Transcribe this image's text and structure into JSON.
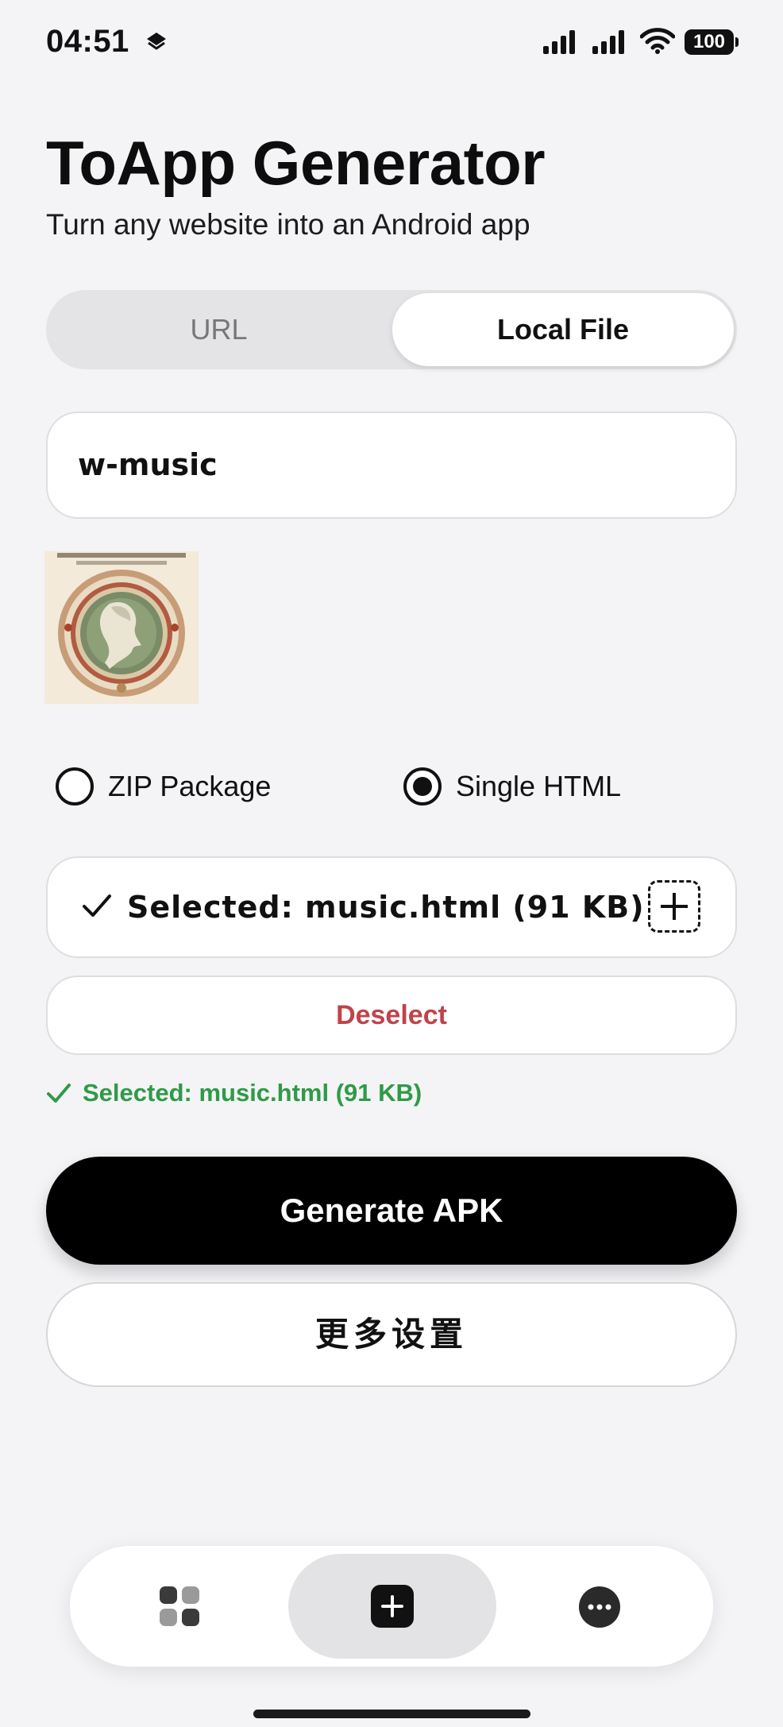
{
  "status_bar": {
    "time": "04:51",
    "battery": "100"
  },
  "header": {
    "title": "ToApp Generator",
    "subtitle": "Turn any website into an Android app"
  },
  "source_tabs": {
    "url_label": "URL",
    "local_file_label": "Local File",
    "active": "Local File"
  },
  "app_name_field": {
    "value": "w-music"
  },
  "package_type": {
    "zip_label": "ZIP Package",
    "html_label": "Single HTML",
    "selected": "Single HTML"
  },
  "file_card": {
    "text": "Selected: music.html (91 KB)"
  },
  "deselect_label": "Deselect",
  "status_message": "Selected: music.html (91 KB)",
  "generate_label": "Generate APK",
  "more_settings_label": "更多设置",
  "tab_bar": {
    "items": [
      "grid-icon",
      "add-icon",
      "more-icon"
    ],
    "active": "add-icon"
  },
  "colors": {
    "accent": "#000000",
    "danger": "#c0434a",
    "success": "#2e9b47",
    "background": "#f4f3f6"
  }
}
